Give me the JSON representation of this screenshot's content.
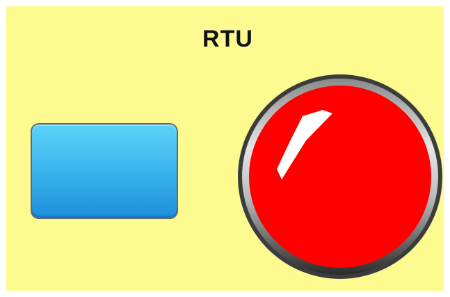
{
  "panel": {
    "background_color": "#fdfa90",
    "title": "RTU"
  },
  "blue_button": {
    "icon": "rectangular-push-button",
    "color": "#3fb7ee"
  },
  "red_button": {
    "icon": "round-push-button",
    "color": "#ff0000",
    "bezel_color": "#555555"
  }
}
